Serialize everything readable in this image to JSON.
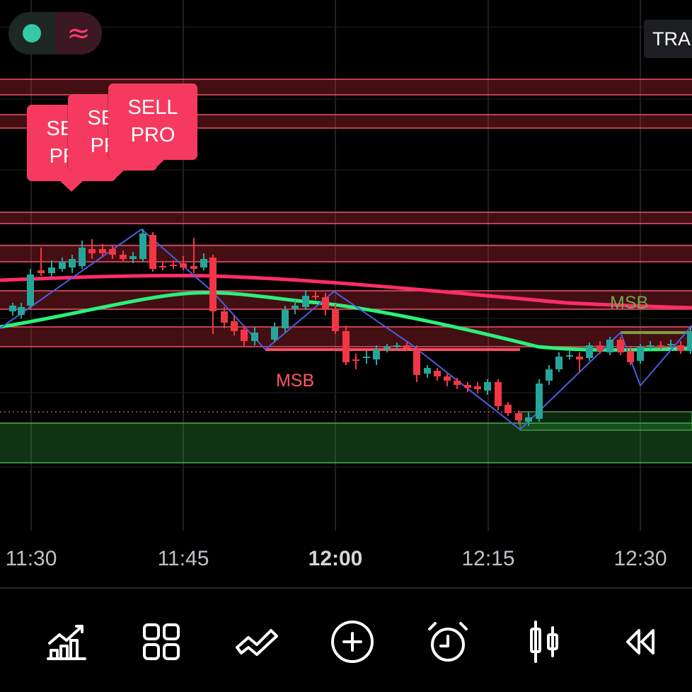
{
  "header": {
    "status_dot": "green-status-dot",
    "wave_symbol": "≈",
    "trade_button": "TRADE"
  },
  "signals": [
    {
      "line1": "SELL",
      "line2": "PRO"
    },
    {
      "line1": "SELL",
      "line2": "PRO"
    },
    {
      "line1": "SELL",
      "line2": "PRO"
    }
  ],
  "annotations": {
    "msb_bear": "MSB",
    "msb_bull": "MSB"
  },
  "time_axis": [
    "11:30",
    "11:45",
    "12:00",
    "12:15",
    "12:30"
  ],
  "colors": {
    "background": "#000000",
    "bull_candle": "#26a69a",
    "bear_candle": "#f23645",
    "ema_fast": "#ff2d68",
    "ema_slow": "#2bf07a",
    "zigzag": "#4a5ee0",
    "resistance_zone": "#f23645",
    "support_zone": "#2ecc40",
    "sell_label": "#f63a5f",
    "msb_bear": "#ff5a5a",
    "msb_bull": "#72a84f"
  },
  "toolbar": [
    {
      "name": "indicators-chart-icon"
    },
    {
      "name": "layouts-grid-icon"
    },
    {
      "name": "drawing-tools-icon"
    },
    {
      "name": "add-plus-circle-icon"
    },
    {
      "name": "alarm-clock-icon"
    },
    {
      "name": "candlestick-type-icon"
    },
    {
      "name": "replay-rewind-icon"
    }
  ]
}
